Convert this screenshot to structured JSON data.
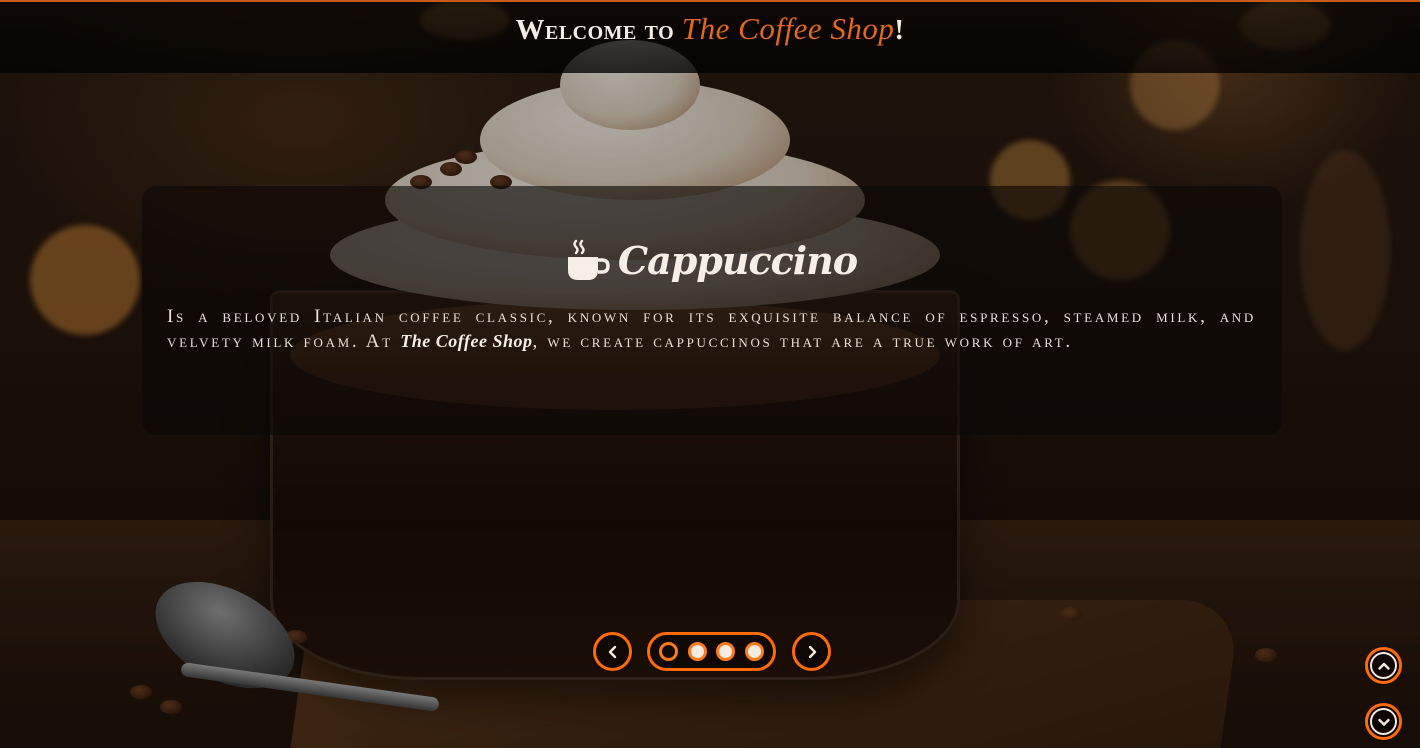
{
  "header": {
    "title_prefix": "Welcome to ",
    "title_brand": "The Coffee Shop",
    "title_suffix": "!"
  },
  "slide": {
    "title": "Cappuccino",
    "icon": "coffee-cup-icon",
    "text_part1": "Is a beloved Italian coffee classic, known for its exquisite balance of espresso, steamed milk, and velvety milk foam. At ",
    "text_brand": "The Coffee Shop",
    "text_part2": ", we create cappuccinos that are a true work of art."
  },
  "carousel": {
    "prev_icon": "chevron-left-icon",
    "next_icon": "chevron-right-icon",
    "slide_count": 4,
    "active_index": 0
  },
  "side_nav": {
    "up_icon": "chevron-up-icon",
    "down_icon": "chevron-down-icon"
  },
  "colors": {
    "accent": "#ff6a0a",
    "brand": "#e2691c",
    "text_light": "#f3ece4"
  }
}
